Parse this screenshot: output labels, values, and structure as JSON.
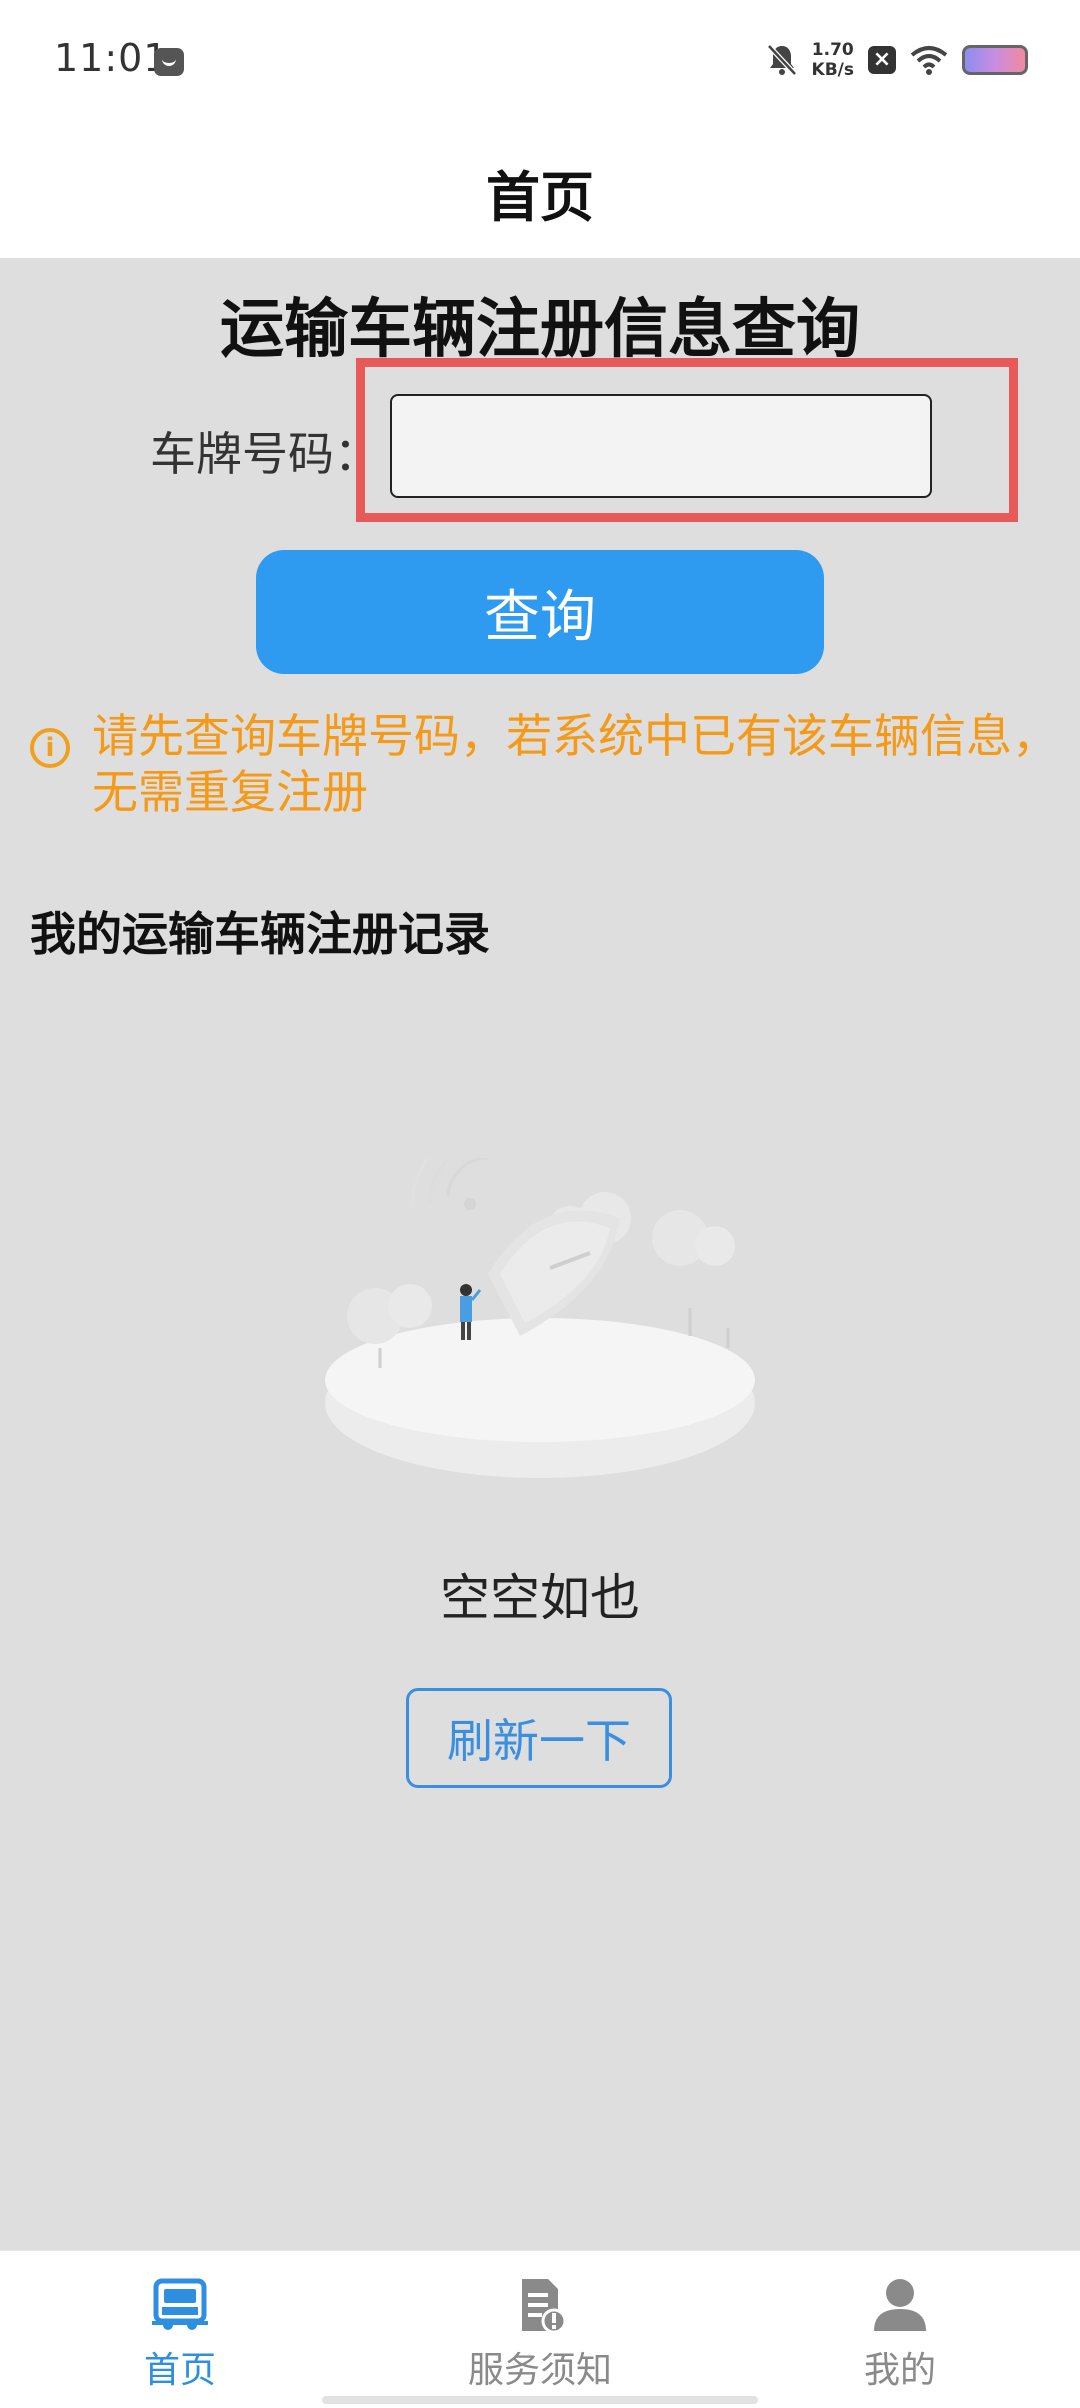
{
  "status_bar": {
    "time": "11:01",
    "speed_value": "1.70",
    "speed_unit": "KB/s"
  },
  "navbar": {
    "title": "首页"
  },
  "query": {
    "title": "运输车辆注册信息查询",
    "plate_label": "车牌号码：",
    "plate_value": "",
    "button_label": "查询",
    "notice": "请先查询车牌号码，若系统中已有该车辆信息，无需重复注册"
  },
  "records": {
    "title": "我的运输车辆注册记录",
    "empty_text": "空空如也",
    "refresh_label": "刷新一下"
  },
  "tabbar": {
    "tabs": [
      {
        "label": "首页",
        "icon": "truck-icon",
        "active": true
      },
      {
        "label": "服务须知",
        "icon": "document-alert-icon",
        "active": false
      },
      {
        "label": "我的",
        "icon": "user-icon",
        "active": false
      }
    ]
  },
  "colors": {
    "accent": "#2e9af0",
    "warning": "#f59a18",
    "highlight_frame": "#e85a5a",
    "background": "#dedede"
  }
}
